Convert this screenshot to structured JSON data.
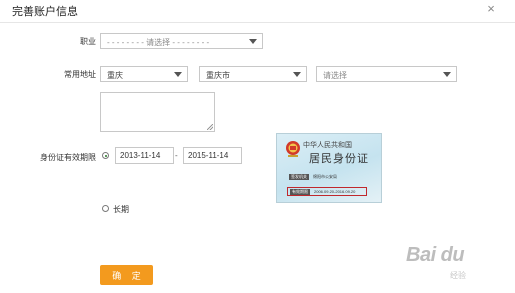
{
  "dialog": {
    "title": "完善账户信息",
    "close_glyph": "×"
  },
  "form": {
    "occupation": {
      "label": "职业",
      "value": "- - - - - - - - 请选择 - - - - - - - -"
    },
    "address": {
      "label": "常用地址",
      "province": "重庆",
      "city": "重庆市",
      "district": "请选择",
      "detail": ""
    },
    "id_validity": {
      "label": "身份证有效期限",
      "start_date": "2013-11-14",
      "separator": "-",
      "end_date": "2015-11-14",
      "long_term_label": "长期",
      "selected_option": "date_range"
    },
    "submit_label": "确 定"
  },
  "id_card_sample": {
    "line1": "中华人民共和国",
    "line2": "居民身份证",
    "authority_label": "签发机关",
    "authority_value": "绵阳市公安局",
    "validity_label": "有效期限",
    "validity_value": "2006.09.20-2016.09.20"
  },
  "watermark": {
    "text": "Bai du",
    "sub": "经验"
  },
  "colors": {
    "accent": "#f39a1e",
    "highlight_box": "#c0282d",
    "radio_dot": "#2a7a2a"
  }
}
